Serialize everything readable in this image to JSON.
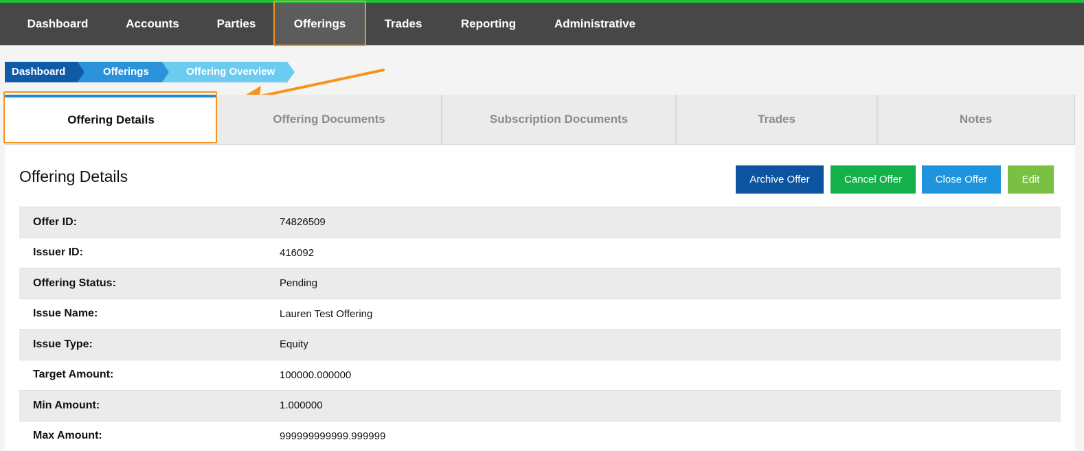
{
  "nav": {
    "items": [
      "Dashboard",
      "Accounts",
      "Parties",
      "Offerings",
      "Trades",
      "Reporting",
      "Administrative"
    ],
    "active": "Offerings"
  },
  "breadcrumb": [
    "Dashboard",
    "Offerings",
    "Offering Overview"
  ],
  "tabs": [
    "Offering Details",
    "Offering Documents",
    "Subscription Documents",
    "Trades",
    "Notes"
  ],
  "panel": {
    "title": "Offering Details",
    "buttons": {
      "archive": "Archive Offer",
      "cancel": "Cancel Offer",
      "close": "Close Offer",
      "edit": "Edit"
    }
  },
  "details": [
    {
      "label": "Offer ID:",
      "value": "74826509"
    },
    {
      "label": "Issuer ID:",
      "value": "416092"
    },
    {
      "label": "Offering Status:",
      "value": "Pending"
    },
    {
      "label": "Issue Name:",
      "value": "Lauren Test Offering"
    },
    {
      "label": "Issue Type:",
      "value": "Equity"
    },
    {
      "label": "Target Amount:",
      "value": "100000.000000"
    },
    {
      "label": "Min Amount:",
      "value": "1.000000"
    },
    {
      "label": "Max Amount:",
      "value": "999999999999.999999"
    }
  ],
  "colors": {
    "nav_bg": "#474747",
    "accent_green": "#1fbf3a",
    "highlight": "#f7941d",
    "crumb1": "#0f5ba7",
    "crumb2": "#2a93dc",
    "crumb3": "#6ccbf1",
    "archive": "#0d54a0",
    "cancel": "#13b04c",
    "close": "#1e94dc",
    "edit": "#7ac143"
  }
}
